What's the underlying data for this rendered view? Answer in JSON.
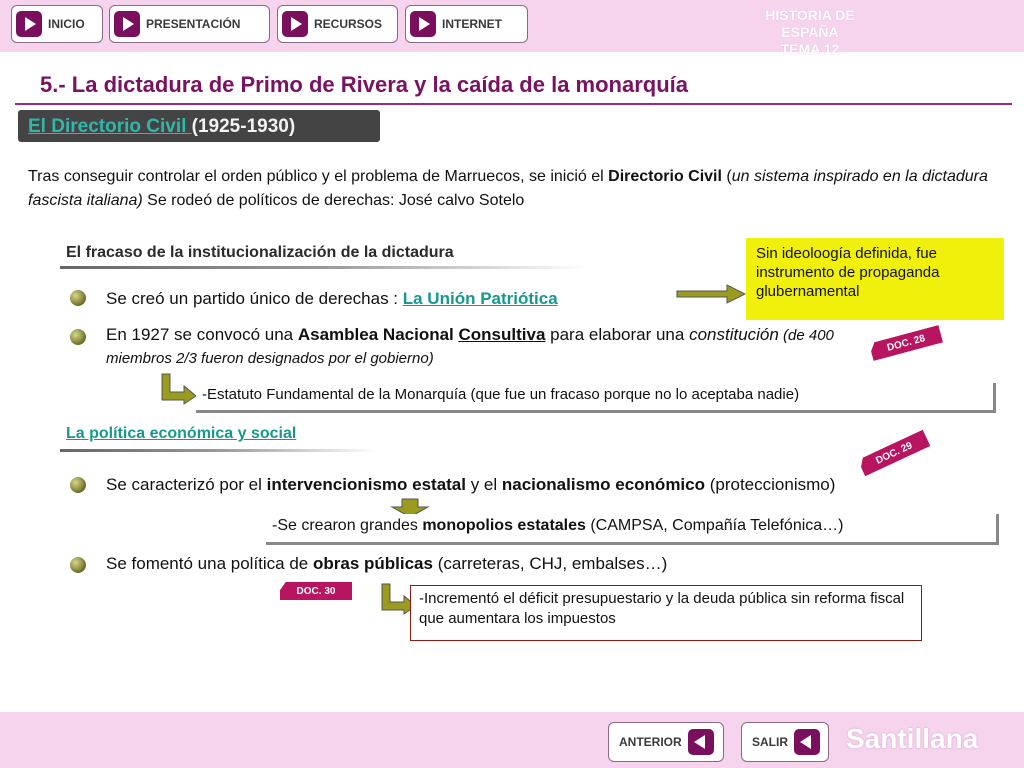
{
  "nav": {
    "items": [
      {
        "label": "INICIO"
      },
      {
        "label": "PRESENTACIÓN"
      },
      {
        "label": "RECURSOS"
      },
      {
        "label": "INTERNET"
      }
    ],
    "brand_line1": "HISTORIA DE ESPAÑA",
    "brand_line2": "TEMA 12"
  },
  "page": {
    "title": "5.- La dictadura de Primo de Rivera y la caída de la monarquía"
  },
  "section": {
    "link_text": "El Directorio Civil ",
    "years": "(1925-1930)"
  },
  "intro": {
    "t1": "Tras conseguir controlar el orden público y el problema de Marruecos, se inició el ",
    "b1": "Directorio Civil",
    "t2": " (",
    "i1": "un sistema inspirado en la dictadura fascista italiana)",
    "t3": " Se rodeó de políticos de derechas: José calvo Sotelo"
  },
  "fracaso": {
    "heading": "El fracaso de la institucionalización de la dictadura",
    "b1_text": "Se creó un partido único de derechas : ",
    "b1_link": "La Unión Patriótica",
    "note": "Sin ideoloogía definida, fue instrumento de propaganda glubernamental",
    "b2_t1": "En 1927 se convocó una ",
    "b2_b1": "Asamblea Nacional ",
    "b2_b2": "Consultiva",
    "b2_t2": " para elaborar una ",
    "b2_i1": "constitución",
    "b2_i2": " (de 400 miembros 2/3 fueron designados por el gobierno)",
    "doc": "DOC. 28",
    "estatuto": "-Estatuto Fundamental de la Monarquía (que fue un fracaso porque no lo aceptaba nadie)"
  },
  "economia": {
    "heading": "La política económica y social",
    "doc1": "DOC. 29",
    "b1_t1": "Se caracterizó por el ",
    "b1_b1": "intervencionismo estatal",
    "b1_t2": " y el ",
    "b1_b2": "nacionalismo económico",
    "b1_t3": " (proteccionismo)",
    "box1_t1": "-Se crearon grandes ",
    "box1_b1": "monopolios estatales",
    "box1_t2": " (CAMPSA, Compañía Telefónica…)",
    "b2_t1": "Se fomentó una política de ",
    "b2_b1": "obras públicas",
    "b2_t2": " (carreteras, CHJ, embalses…)",
    "doc2": "DOC. 30",
    "box2": "-Incrementó el déficit presupuestario y la deuda pública sin reforma fiscal que aumentara los impuestos"
  },
  "footer": {
    "anterior": "ANTERIOR",
    "salir": "SALIR",
    "logo": "Santillana"
  },
  "colors": {
    "accent": "#7a1262",
    "band": "#f7d4ee",
    "link": "#16998c",
    "note": "#f1f00a",
    "doc": "#b8145f"
  },
  "icons": [
    "play-icon",
    "back-icon",
    "bullet-icon",
    "arrow-right-icon",
    "arrow-down-icon",
    "l-arrow-icon"
  ]
}
